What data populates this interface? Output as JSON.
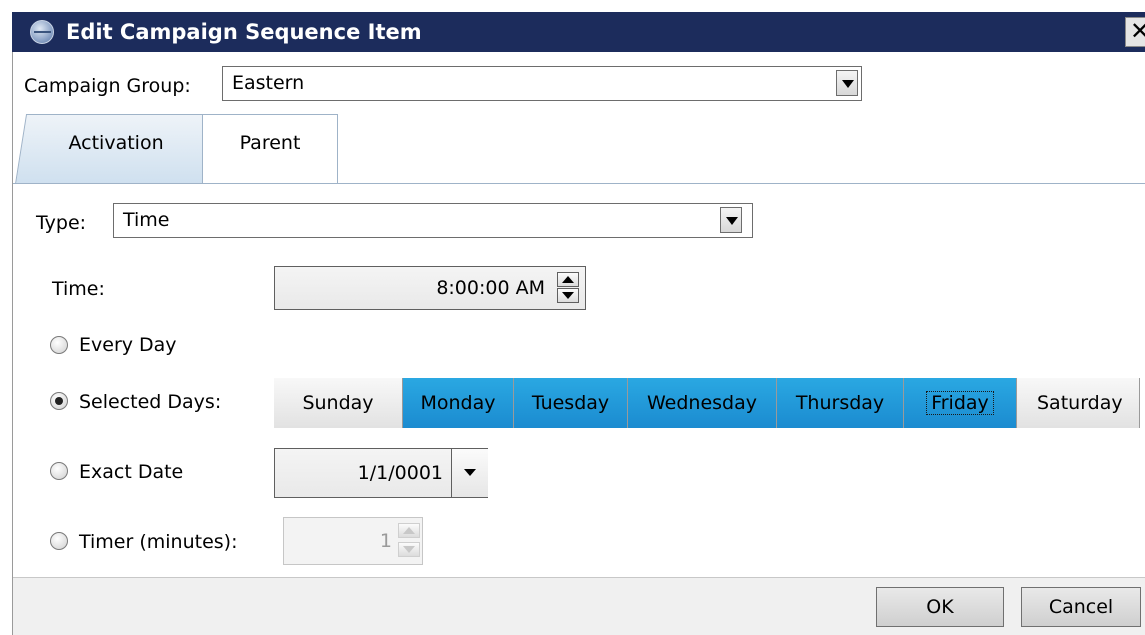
{
  "window": {
    "title": "Edit Campaign Sequence Item",
    "close_glyph": "✕"
  },
  "campaign_group": {
    "label": "Campaign Group:",
    "value": "Eastern"
  },
  "tabs": [
    {
      "label": "Activation",
      "selected": false
    },
    {
      "label": "Parent",
      "selected": true
    }
  ],
  "type": {
    "label": "Type:",
    "value": "Time"
  },
  "time": {
    "label": "Time:",
    "value": "8:00:00 AM"
  },
  "schedule": {
    "every_day": {
      "label": "Every Day",
      "checked": false
    },
    "selected_days": {
      "label": "Selected Days:",
      "checked": true
    },
    "exact_date": {
      "label": "Exact Date",
      "checked": false,
      "value": "1/1/0001"
    },
    "timer": {
      "label": "Timer (minutes):",
      "checked": false,
      "value": "1"
    }
  },
  "days": [
    {
      "label": "Sunday",
      "selected": false
    },
    {
      "label": "Monday",
      "selected": true
    },
    {
      "label": "Tuesday",
      "selected": true
    },
    {
      "label": "Wednesday",
      "selected": true
    },
    {
      "label": "Thursday",
      "selected": true
    },
    {
      "label": "Friday",
      "selected": true,
      "focused": true
    },
    {
      "label": "Saturday",
      "selected": false
    }
  ],
  "buttons": {
    "ok": "OK",
    "cancel": "Cancel"
  },
  "colors": {
    "titlebar": "#1c2c5c",
    "day_selected": "#1b8bd0"
  }
}
